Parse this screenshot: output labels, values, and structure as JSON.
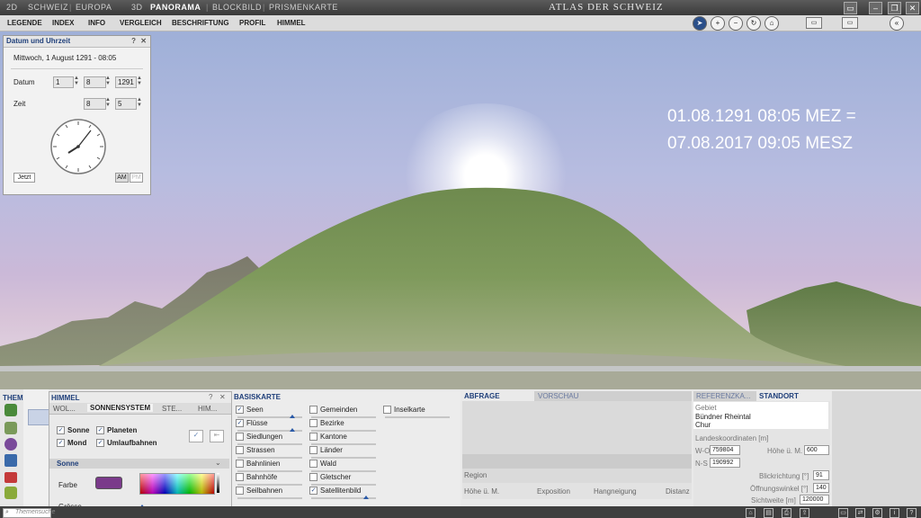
{
  "topbar": {
    "mode_2d": "2D",
    "schweiz": "SCHWEIZ",
    "europa": "EUROPA",
    "mode_3d": "3D",
    "panorama": "PANORAMA",
    "blockbild": "BLOCKBILD",
    "prismenkarte": "PRISMENKARTE",
    "app_title": "ATLAS DER SCHWEIZ"
  },
  "menu": [
    "LEGENDE",
    "INDEX",
    "INFO",
    "VERGLEICH",
    "BESCHRIFTUNG",
    "PROFIL",
    "HIMMEL"
  ],
  "overlay": {
    "line1": "01.08.1291 08:05 MEZ =",
    "line2": "07.08.2017 09:05 MESZ"
  },
  "date_panel": {
    "title": "Datum und Uhrzeit",
    "summary": "Mittwoch, 1 August 1291 - 08:05",
    "datum_label": "Datum",
    "day": "1",
    "month": "8",
    "year": "1291",
    "zeit_label": "Zeit",
    "hour": "8",
    "minute": "5",
    "jetzt": "Jetzt",
    "am": "AM",
    "pm": "PM"
  },
  "thema": {
    "label": "THEMA",
    "search_placeholder": "Themensuche"
  },
  "himmel": {
    "label": "HIMMEL",
    "tabs": [
      "WOL...",
      "SONNENSYSTEM",
      "STE...",
      "HIM..."
    ],
    "checks": [
      {
        "label": "Sonne",
        "checked": true
      },
      {
        "label": "Planeten",
        "checked": true
      },
      {
        "label": "Mond",
        "checked": true
      },
      {
        "label": "Umlaufbahnen",
        "checked": true
      }
    ],
    "section": "Sonne",
    "farbe": "Farbe",
    "groesse": "Grösse",
    "sun_color": "#7a3a8a"
  },
  "basiskarte": {
    "label": "BASISKARTE",
    "col1": [
      {
        "label": "Seen",
        "checked": true
      },
      {
        "label": "Flüsse",
        "checked": true
      },
      {
        "label": "Siedlungen",
        "checked": false
      },
      {
        "label": "Strassen",
        "checked": false
      },
      {
        "label": "Bahnlinien",
        "checked": false
      },
      {
        "label": "Bahnhöfe",
        "checked": false
      },
      {
        "label": "Seilbahnen",
        "checked": false
      }
    ],
    "col2": [
      {
        "label": "Gemeinden",
        "checked": false
      },
      {
        "label": "Bezirke",
        "checked": false
      },
      {
        "label": "Kantone",
        "checked": false
      },
      {
        "label": "Länder",
        "checked": false
      },
      {
        "label": "Wald",
        "checked": false
      },
      {
        "label": "Gletscher",
        "checked": false
      },
      {
        "label": "Satellitenbild",
        "checked": true
      }
    ],
    "col3": [
      {
        "label": "Inselkarte",
        "checked": false
      }
    ]
  },
  "abfrage": {
    "tab1": "ABFRAGE",
    "tab2": "VORSCHAU",
    "region": "Region",
    "columns": [
      "Höhe ü. M.",
      "Exposition",
      "Hangneigung",
      "Distanz"
    ]
  },
  "standort": {
    "tab1": "REFERENZKA...",
    "tab2": "STANDORT",
    "gebiet_label": "Gebiet",
    "gebiet1": "Bündner Rheintal",
    "gebiet2": "Chur",
    "koord_label": "Landeskoordinaten [m]",
    "wo_label": "W-O",
    "wo_value": "759804",
    "ns_label": "N-S",
    "ns_value": "190992",
    "hoehe_label": "Höhe ü. M.",
    "hoehe_value": "600",
    "blick_label": "Blickrichtung [°]",
    "blick_value": "91",
    "oeff_label": "Öffnungswinkel [°]",
    "oeff_value": "140",
    "sicht_label": "Sichtweite [m]",
    "sicht_value": "120000"
  }
}
